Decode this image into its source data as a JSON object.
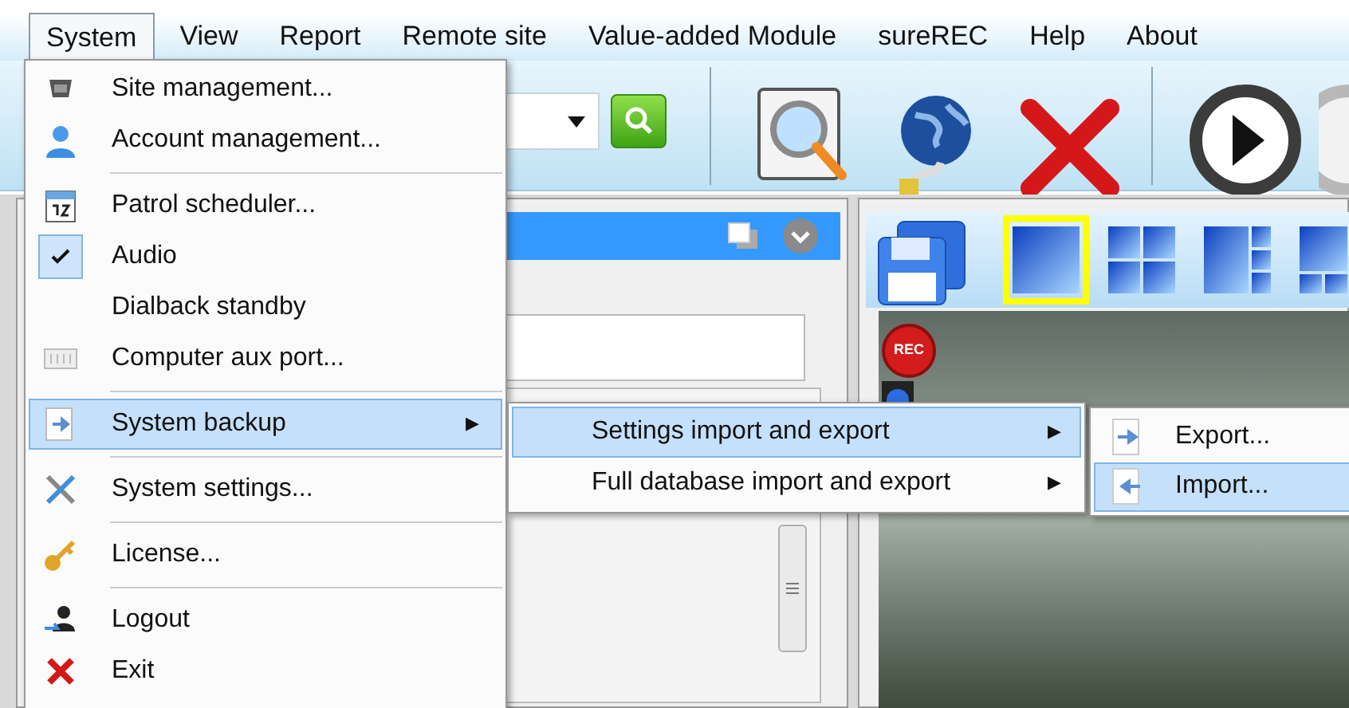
{
  "menubar": [
    {
      "label": "System",
      "selected": true
    },
    {
      "label": "View",
      "selected": false
    },
    {
      "label": "Report",
      "selected": false
    },
    {
      "label": "Remote site",
      "selected": false
    },
    {
      "label": "Value-added Module",
      "selected": false
    },
    {
      "label": "sureREC",
      "selected": false
    },
    {
      "label": "Help",
      "selected": false
    },
    {
      "label": "About",
      "selected": false
    }
  ],
  "system_menu": [
    {
      "kind": "command",
      "label": "Site management...",
      "selected": false
    },
    {
      "kind": "command",
      "label": "Account management...",
      "selected": false
    },
    {
      "kind": "separator"
    },
    {
      "kind": "command",
      "label": "Patrol scheduler...",
      "selected": false
    },
    {
      "kind": "check",
      "label": "Audio",
      "checked": true,
      "selected": false
    },
    {
      "kind": "command",
      "label": "Dialback standby",
      "selected": false
    },
    {
      "kind": "command",
      "label": "Computer aux port...",
      "selected": false
    },
    {
      "kind": "separator"
    },
    {
      "kind": "submenu",
      "label": "System backup",
      "arrow": "▶",
      "selected": true
    },
    {
      "kind": "separator"
    },
    {
      "kind": "command",
      "label": "System settings...",
      "selected": false
    },
    {
      "kind": "separator"
    },
    {
      "kind": "command",
      "label": "License...",
      "selected": false
    },
    {
      "kind": "separator"
    },
    {
      "kind": "command",
      "label": "Logout",
      "selected": false
    },
    {
      "kind": "command",
      "label": "Exit",
      "selected": false
    }
  ],
  "backup_menu": [
    {
      "label": "Settings import and export",
      "arrow": "▶",
      "selected": true
    },
    {
      "label": "Full database import and export",
      "arrow": "▶",
      "selected": false
    }
  ],
  "settings_menu": [
    {
      "label": "Export...",
      "selected": false
    },
    {
      "label": "Import...",
      "selected": true
    }
  ],
  "layouts": [
    {
      "selected": true
    },
    {
      "selected": false
    },
    {
      "selected": false
    },
    {
      "selected": false
    }
  ],
  "video": {
    "rec_button": "REC"
  }
}
